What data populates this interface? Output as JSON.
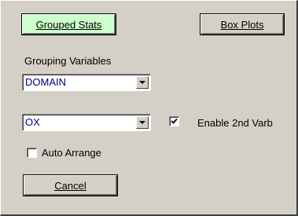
{
  "buttons": {
    "grouped_stats": "Grouped Stats",
    "box_plots": "Box Plots",
    "cancel": "Cancel"
  },
  "grouping": {
    "label": "Grouping Variables",
    "var1_value": "DOMAIN",
    "var2_value": "OX"
  },
  "options": {
    "enable_2nd_label": "Enable 2nd Varb",
    "enable_2nd_checked": true,
    "auto_arrange_label": "Auto Arrange",
    "auto_arrange_checked": false
  },
  "icons": {
    "dropdown": "chevron-down-icon",
    "checkmark": "checkmark-icon"
  },
  "colors": {
    "background": "#d4d0c8",
    "grouped_stats_button": "#ccffcc",
    "selected_text": "#000080"
  }
}
